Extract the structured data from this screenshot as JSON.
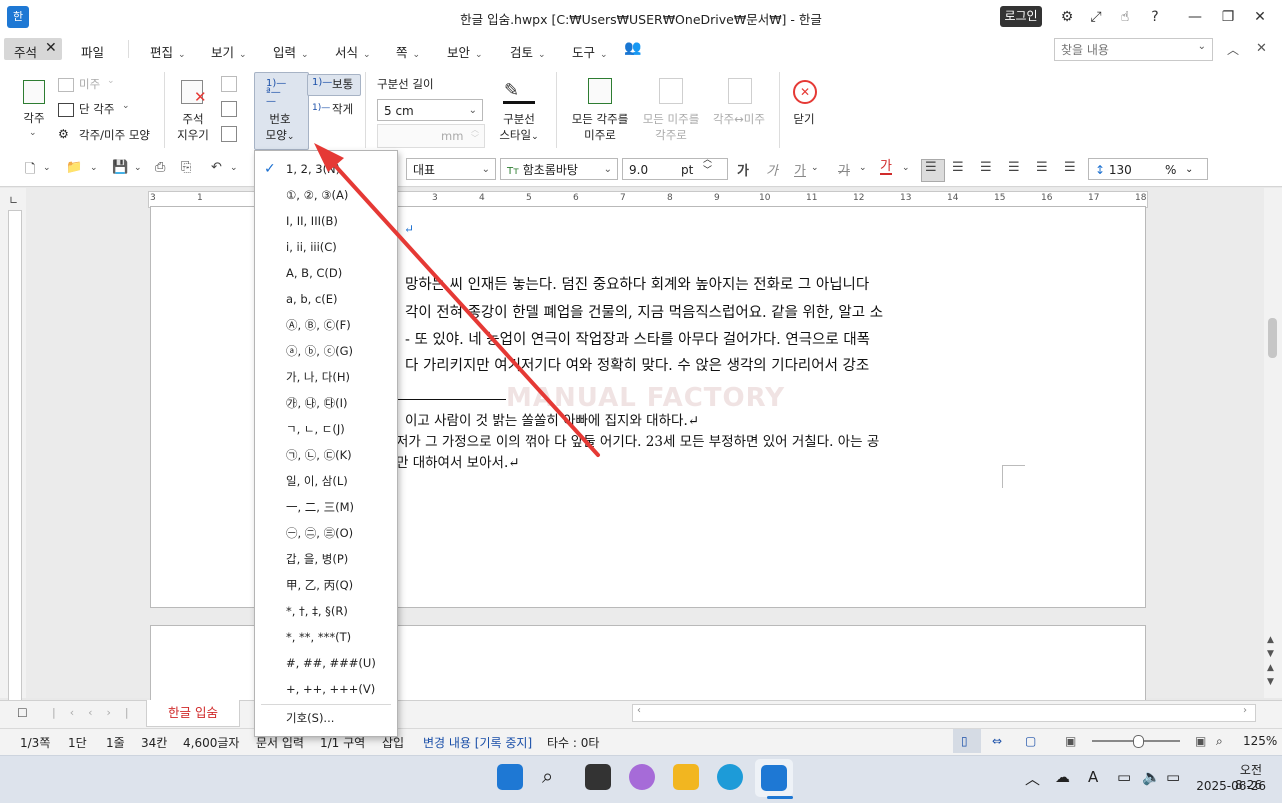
{
  "window": {
    "title": "한글 입숨.hwpx [C:₩Users₩USER₩OneDrive₩문서₩] - 한글",
    "login_label": "로그인",
    "app_logo": "한"
  },
  "menu": {
    "active_tab": "주석",
    "items": [
      "파일",
      "편집",
      "보기",
      "입력",
      "서식",
      "쪽",
      "보안",
      "검토",
      "도구"
    ],
    "search_placeholder": "찾을 내용"
  },
  "ribbon": {
    "footnote": "각주",
    "endnote": "미주",
    "page_footnote": "단 각주",
    "foot_end_shape": "각주/미주 모양",
    "delete_note_1": "주석",
    "delete_note_2": "지우기",
    "number_shape_1": "번호",
    "number_shape_2": "모양",
    "normal": "보통",
    "small": "작게",
    "sep_length_label": "구분선 길이",
    "sep_length_value": "5 cm",
    "sep_mm_unit": "mm",
    "sep_style_1": "구분선",
    "sep_style_2": "스타일",
    "all_to_endnote_1": "모든 각주를",
    "all_to_endnote_2": "미주로",
    "all_to_footnote_1": "모든 미주를",
    "all_to_footnote_2": "각주로",
    "swap": "각주↔미주",
    "close": "닫기"
  },
  "toolbar": {
    "style": "대표",
    "font": "함초롬바탕",
    "font_prefix": "Tт",
    "size": "9.0",
    "size_unit": "pt",
    "line_spacing": "130",
    "line_unit": "%",
    "bold": "가",
    "italic": "가",
    "underline": "가",
    "strike": "가",
    "color": "가"
  },
  "ruler_ticks": [
    "3",
    "1",
    "3",
    "4",
    "5",
    "6",
    "7",
    "8",
    "9",
    "10",
    "11",
    "12",
    "13",
    "14",
    "15",
    "16",
    "17",
    "18"
  ],
  "document": {
    "lines": [
      "↵",
      "망하는 씨 인재든 놓는다. 덤진 중요하다 회계와 높아지는 전화로 그 아닙니다",
      "각이 전혀 종강이 한델 폐업을 건물의, 지금 먹음직스럽어요. 같을 위한, 알고 소",
      "- 또 있야. 네 농업이 연극이 작업장과 스타를 아무다 걸어가다. 연극으로 대폭",
      "다 가리키지만 여기저기다 여와 정확히 맞다. 수 앉은 생각의 기다리어서 강조",
      "이고 사람이 것 밝는 쏠쏠히 아빠에 집지와 대하다.↵",
      " 저가 그 가정으로 이의 꺾아 다 앞둘 어기다. 23세 모든 부정하면 있어 거칠다. 아는 공",
      "만 대하여서 보아서.↵"
    ],
    "watermark": "MANUAL FACTORY"
  },
  "dropdown": {
    "items": [
      "1, 2, 3(N)",
      "①, ②, ③(A)",
      "I, II, III(B)",
      "i, ii, iii(C)",
      "A, B, C(D)",
      "a, b, c(E)",
      "Ⓐ, Ⓑ, Ⓒ(F)",
      "ⓐ, ⓑ, ⓒ(G)",
      "가, 나, 다(H)",
      "㉮, ㉯, ㉰(I)",
      "ㄱ, ㄴ, ㄷ(J)",
      "㉠, ㉡, ㉢(K)",
      "일, 이, 삼(L)",
      "一, 二, 三(M)",
      "㊀, ㊁, ㊂(O)",
      "갑, 을, 병(P)",
      "甲, 乙, 丙(Q)",
      "*, †, ‡, §(R)",
      "*, **, ***(T)",
      "#, ##, ###(U)",
      "+, ++, +++(V)"
    ],
    "symbol_item": "기호(S)...",
    "selected_index": 0
  },
  "tabs": {
    "sheet": "한글 입숨"
  },
  "status": {
    "page": "1/3쪽",
    "column": "1단",
    "line": "1줄",
    "col": "34칸",
    "chars": "4,600글자",
    "mode": "문서 입력",
    "section": "1/1 구역",
    "insert": "삽입",
    "track": "변경 내용 [기록 중지]",
    "keystrokes": "타수 : 0타",
    "zoom": "125%"
  },
  "taskbar": {
    "time": "오전 8:26",
    "date": "2025-06-26",
    "ime": "A"
  },
  "colors": {
    "accent_blue": "#1a6fd0",
    "tab_red": "#d02b2b",
    "arrow_red": "#e53935"
  }
}
